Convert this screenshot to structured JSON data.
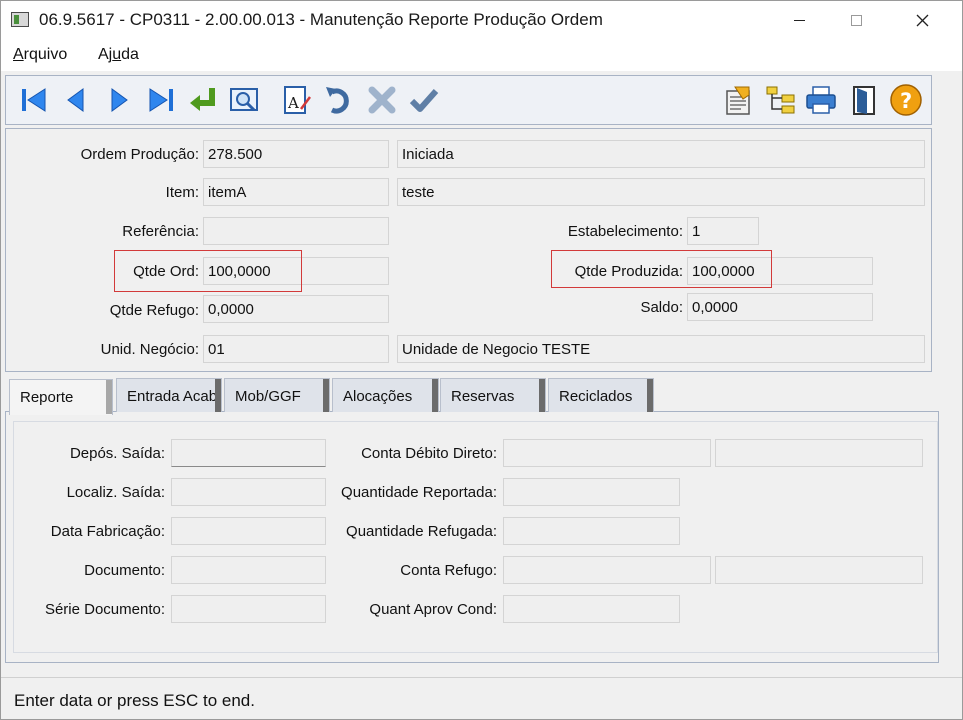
{
  "window": {
    "title": "06.9.5617 - CP0311 - 2.00.00.013 - Manutenção Reporte Produção Ordem"
  },
  "menu": {
    "items": [
      {
        "prefix": "",
        "underline": "A",
        "rest": "rquivo"
      },
      {
        "prefix": "Aj",
        "underline": "u",
        "rest": "da"
      }
    ]
  },
  "toolbar": {
    "icons": [
      "first-record-icon",
      "previous-record-icon",
      "next-record-icon",
      "last-record-icon",
      "goto-icon",
      "search-icon",
      "edit-text-icon",
      "undo-icon",
      "cancel-icon",
      "confirm-icon",
      "report-icon",
      "hierarchy-icon",
      "print-icon",
      "exit-icon",
      "help-icon"
    ]
  },
  "header": {
    "ordem_producao": {
      "label": "Ordem Produção:",
      "value": "278.500",
      "status": "Iniciada"
    },
    "item": {
      "label": "Item:",
      "value": "itemA",
      "description": "teste"
    },
    "referencia": {
      "label": "Referência:",
      "value": ""
    },
    "estabelecimento": {
      "label": "Estabelecimento:",
      "value": "1"
    },
    "qtde_ord": {
      "label": "Qtde Ord:",
      "value": "100,0000"
    },
    "qtde_produzida": {
      "label": "Qtde Produzida:",
      "value": "100,0000"
    },
    "qtde_refugo": {
      "label": "Qtde Refugo:",
      "value": "0,0000"
    },
    "saldo": {
      "label": "Saldo:",
      "value": "0,0000"
    },
    "unid_negocio": {
      "label": "Unid. Negócio:",
      "value": "01",
      "description": "Unidade de Negocio TESTE"
    }
  },
  "tabs": [
    {
      "label": "Reporte",
      "active": true
    },
    {
      "label": "Entrada Acabado",
      "active": false
    },
    {
      "label": "Mob/GGF",
      "active": false
    },
    {
      "label": "Alocações",
      "active": false
    },
    {
      "label": "Reservas",
      "active": false
    },
    {
      "label": "Reciclados",
      "active": false
    }
  ],
  "reporte": {
    "depos_saida": {
      "label": "Depós. Saída:",
      "value": ""
    },
    "localiz_saida": {
      "label": "Localiz. Saída:",
      "value": ""
    },
    "data_fabricacao": {
      "label": "Data Fabricação:",
      "value": ""
    },
    "documento": {
      "label": "Documento:",
      "value": ""
    },
    "serie_documento": {
      "label": "Série Documento:",
      "value": ""
    },
    "conta_debito_direto": {
      "label": "Conta Débito Direto:",
      "value": "",
      "value2": ""
    },
    "quantidade_reportada": {
      "label": "Quantidade Reportada:",
      "value": ""
    },
    "quantidade_refugada": {
      "label": "Quantidade Refugada:",
      "value": ""
    },
    "conta_refugo": {
      "label": "Conta Refugo:",
      "value": "",
      "value2": ""
    },
    "quant_aprov_cond": {
      "label": "Quant Aprov Cond:",
      "value": ""
    }
  },
  "status": {
    "text": "Enter data or press ESC to end."
  },
  "colors": {
    "toolbar_blue": "#1f6fd6",
    "highlight_red": "#d23a3a",
    "help_orange": "#f0a010"
  }
}
